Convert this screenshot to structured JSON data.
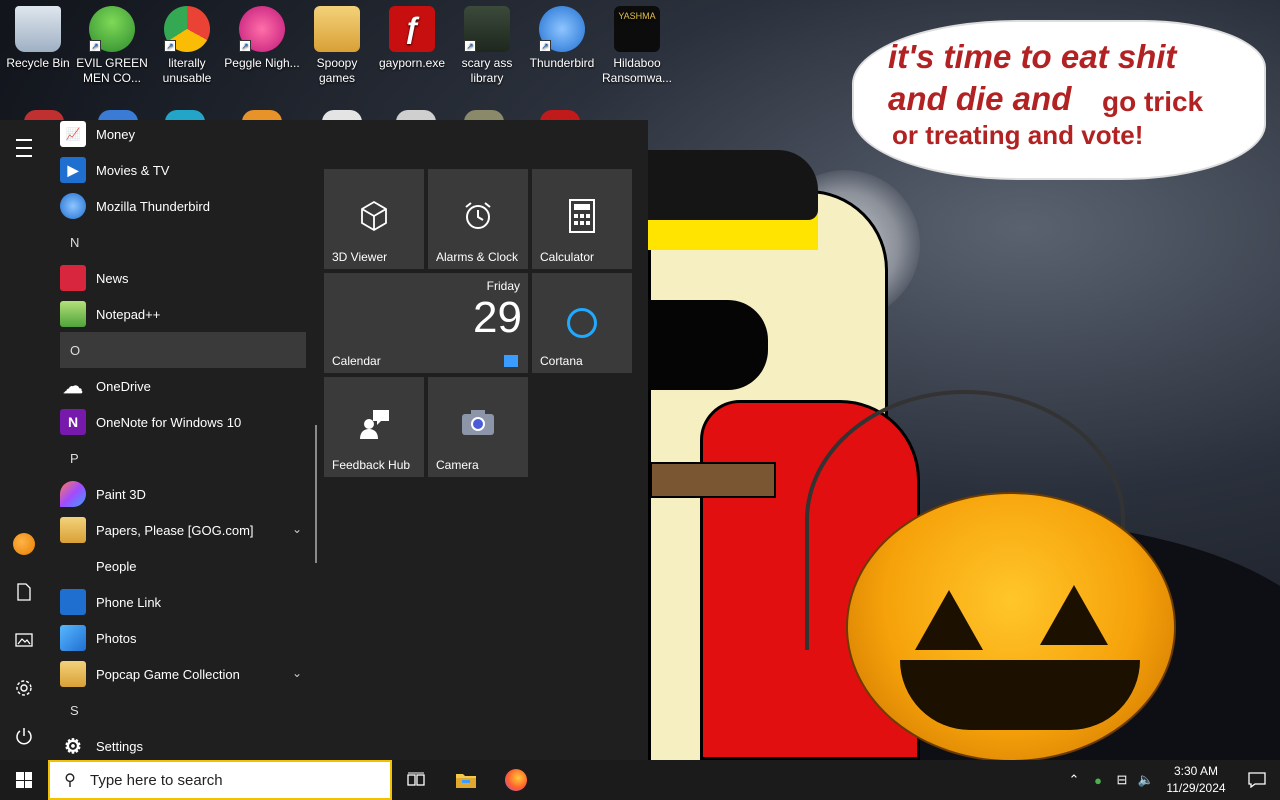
{
  "wallpaper": {
    "speech_line1": "it's time to eat shit",
    "speech_line2": "and die and",
    "speech_line2b": "go trick",
    "speech_line3": "or treating and vote!"
  },
  "desktop_icons": [
    {
      "label": "Recycle Bin",
      "icon": "recycle-bin-icon"
    },
    {
      "label": "EVIL GREEN MEN CO...",
      "icon": "evil-green-men-icon"
    },
    {
      "label": "literally unusable",
      "icon": "chrome-icon"
    },
    {
      "label": "Peggle Nigh...",
      "icon": "peggle-icon"
    },
    {
      "label": "Spoopy games",
      "icon": "folder-icon"
    },
    {
      "label": "gayporn.exe",
      "icon": "flash-icon"
    },
    {
      "label": "scary ass library",
      "icon": "library-icon"
    },
    {
      "label": "Thunderbird",
      "icon": "thunderbird-icon"
    },
    {
      "label": "Hildaboo Ransomwa...",
      "icon": "yashma-icon"
    }
  ],
  "start_menu": {
    "apps": [
      {
        "label": "Money",
        "type": "app",
        "icon": "money-icon"
      },
      {
        "label": "Movies & TV",
        "type": "app",
        "icon": "movies-tv-icon"
      },
      {
        "label": "Mozilla Thunderbird",
        "type": "app",
        "icon": "thunderbird-icon"
      },
      {
        "label": "N",
        "type": "letter"
      },
      {
        "label": "News",
        "type": "app",
        "icon": "news-icon"
      },
      {
        "label": "Notepad++",
        "type": "app",
        "icon": "notepad-plus-plus-icon"
      },
      {
        "label": "O",
        "type": "letter"
      },
      {
        "label": "OneDrive",
        "type": "app",
        "icon": "onedrive-icon"
      },
      {
        "label": "OneNote for Windows 10",
        "type": "app",
        "icon": "onenote-icon"
      },
      {
        "label": "P",
        "type": "letter"
      },
      {
        "label": "Paint 3D",
        "type": "app",
        "icon": "paint-3d-icon"
      },
      {
        "label": "Papers, Please [GOG.com]",
        "type": "folder",
        "icon": "folder-icon"
      },
      {
        "label": "People",
        "type": "app",
        "icon": "people-icon"
      },
      {
        "label": "Phone Link",
        "type": "app",
        "icon": "phone-link-icon"
      },
      {
        "label": "Photos",
        "type": "app",
        "icon": "photos-icon"
      },
      {
        "label": "Popcap Game Collection",
        "type": "folder",
        "icon": "folder-icon"
      },
      {
        "label": "S",
        "type": "letter"
      },
      {
        "label": "Settings",
        "type": "app",
        "icon": "settings-gear-icon"
      }
    ],
    "tiles": {
      "viewer": "3D Viewer",
      "alarms": "Alarms & Clock",
      "calculator": "Calculator",
      "calendar": "Calendar",
      "calendar_day": "Friday",
      "calendar_date": "29",
      "cortana": "Cortana",
      "feedback": "Feedback Hub",
      "camera": "Camera"
    }
  },
  "taskbar": {
    "search_placeholder": "Type here to search",
    "time": "3:30 AM",
    "date": "11/29/2024"
  },
  "colors": {
    "accent": "#1fa9ff",
    "search_border": "#f2c200",
    "speech_text": "#b22222"
  }
}
